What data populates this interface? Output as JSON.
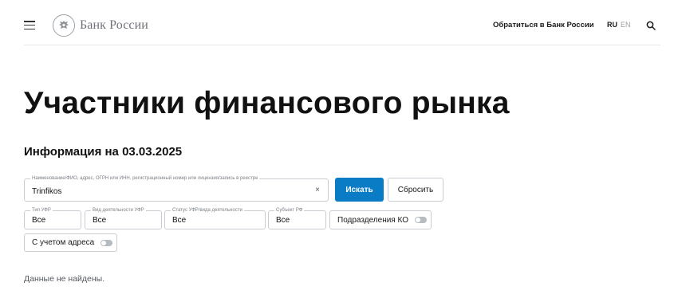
{
  "header": {
    "logo_text": "Банк России",
    "contact_link": "Обратиться в Банк России",
    "lang_ru": "RU",
    "lang_en": "EN"
  },
  "page": {
    "title": "Участники финансового рынка",
    "info_date": "Информация на 03.03.2025"
  },
  "search": {
    "legend": "Наименование/ФИО, адрес, ОГРН или ИНН, регистрационный номер или лицензия/запись в реестре",
    "value": "Trinfikos",
    "clear": "×",
    "search_button": "Искать",
    "reset_button": "Сбросить"
  },
  "filters": {
    "type": {
      "legend": "Тип УФР",
      "value": "Все"
    },
    "activity": {
      "legend": "Вид деятельности УФР",
      "value": "Все"
    },
    "status": {
      "legend": "Статус УФР/вида деятельности",
      "value": "Все"
    },
    "subject": {
      "legend": "Субъект РФ",
      "value": "Все"
    },
    "ko_divisions": {
      "label": "Подразделения КО",
      "enabled": false
    },
    "with_address": {
      "label": "С учетом адреса",
      "enabled": false
    }
  },
  "results": {
    "message": "Данные не найдены."
  }
}
